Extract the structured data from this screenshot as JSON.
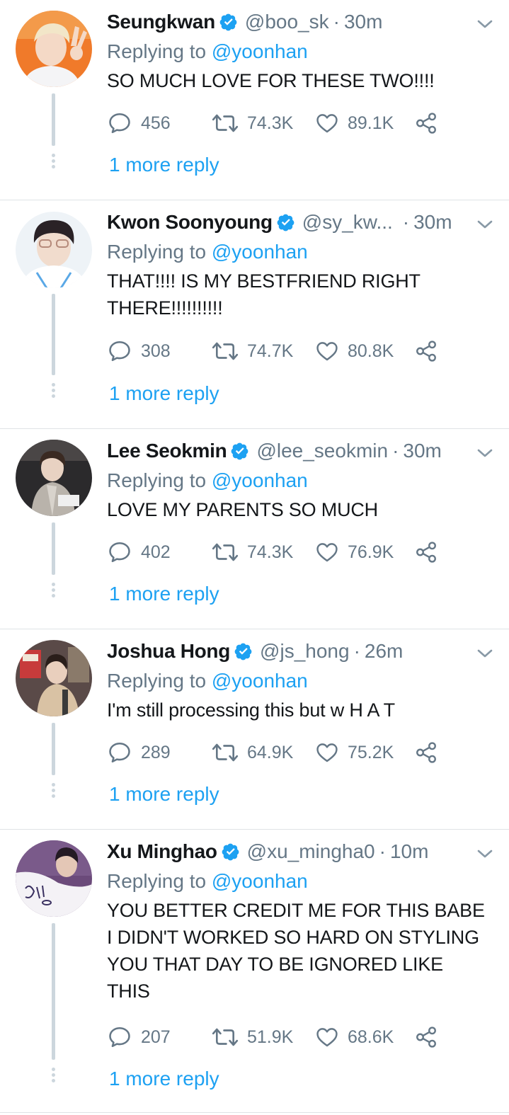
{
  "colors": {
    "link": "#1da1f2",
    "muted": "#657786",
    "text": "#14171a",
    "thread": "#ccd6dd",
    "divider": "#dfe3e6"
  },
  "icons": [
    "verified-badge-icon",
    "caret-down-icon",
    "reply-icon",
    "retweet-icon",
    "like-icon",
    "share-icon"
  ],
  "tweets": [
    {
      "name": "Seungkwan",
      "handle": "@boo_sk",
      "dot": "·",
      "time": "30m",
      "replying_prefix": "Replying to ",
      "replying_to": "@yoonhan",
      "text": "SO MUCH LOVE FOR THESE TWO!!!!",
      "replies": "456",
      "retweets": "74.3K",
      "likes": "89.1K",
      "more_reply": "1 more reply"
    },
    {
      "name": "Kwon Soonyoung",
      "handle": "@sy_kw...",
      "dot": "·",
      "time": "30m",
      "replying_prefix": "Replying to ",
      "replying_to": "@yoonhan",
      "text": "THAT!!!! IS MY BESTFRIEND RIGHT\nTHERE!!!!!!!!!!",
      "replies": "308",
      "retweets": "74.7K",
      "likes": "80.8K",
      "more_reply": "1 more reply"
    },
    {
      "name": "Lee Seokmin",
      "handle": "@lee_seokmin",
      "dot": "·",
      "time": "30m",
      "replying_prefix": "Replying to ",
      "replying_to": "@yoonhan",
      "text": "LOVE MY PARENTS SO MUCH",
      "replies": "402",
      "retweets": "74.3K",
      "likes": "76.9K",
      "more_reply": "1 more reply"
    },
    {
      "name": "Joshua Hong",
      "handle": "@js_hong",
      "dot": "·",
      "time": "26m",
      "replying_prefix": "Replying to ",
      "replying_to": "@yoonhan",
      "text": "I'm still processing this but w H A T",
      "replies": "289",
      "retweets": "64.9K",
      "likes": "75.2K",
      "more_reply": "1 more reply"
    },
    {
      "name": "Xu Minghao",
      "handle": "@xu_mingha0",
      "dot": "·",
      "time": "10m",
      "replying_prefix": "Replying to ",
      "replying_to": "@yoonhan",
      "text": "YOU BETTER CREDIT ME FOR THIS BABE\nI DIDN'T WORKED SO HARD ON STYLING\nYOU THAT DAY TO BE IGNORED LIKE\nTHIS",
      "replies": "207",
      "retweets": "51.9K",
      "likes": "68.6K",
      "more_reply": "1 more reply"
    }
  ]
}
